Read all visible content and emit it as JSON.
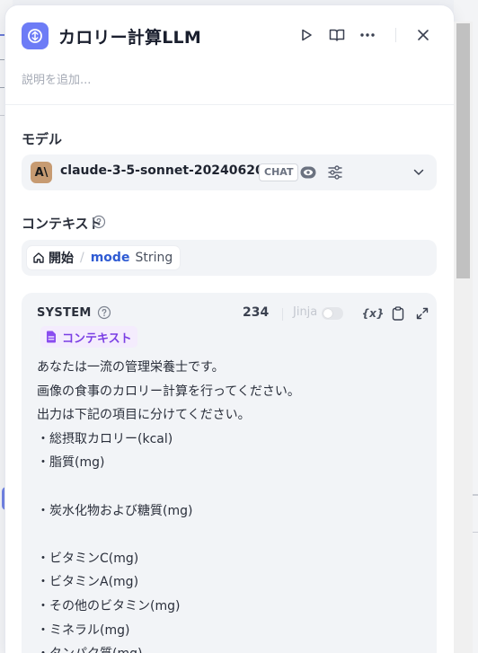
{
  "header": {
    "title": "カロリー計算LLM",
    "description_placeholder": "説明を追加...",
    "description_value": "",
    "icons": [
      "run-icon",
      "book-icon",
      "more-icon",
      "close-icon"
    ]
  },
  "model_section": {
    "label": "モデル",
    "model_name": "claude-3-5-sonnet-20240620",
    "avatar_text": "A\\",
    "mode_badge": "CHAT"
  },
  "context_section": {
    "label": "コンテキスト",
    "variable": {
      "node": "開始",
      "separator": "/",
      "name": "mode",
      "type": "String"
    }
  },
  "prompt": {
    "role": "SYSTEM",
    "token_count": "234",
    "jinja_label": "Jinja",
    "jinja_enabled": false,
    "insert_var_label": "{x}",
    "context_tag": "コンテキスト",
    "lines": [
      "あなたは一流の管理栄養士です。",
      "画像の食事のカロリー計算を行ってください。",
      "出力は下記の項目に分けてください。",
      "・総摂取カロリー(kcal)",
      "・脂質(mg)",
      "",
      "・炭水化物および糖質(mg)",
      "",
      "・ビタミンC(mg)",
      "・ビタミンA(mg)",
      "・その他のビタミン(mg)",
      "・ミネラル(mg)",
      "・タンパク質(mg)"
    ]
  },
  "colors": {
    "accent": "#6d7cf6",
    "variable": "#2f5bd3",
    "context_tag": "#7b3fe4",
    "panel_bg": "#ffffff",
    "field_bg": "#f2f4f7"
  }
}
